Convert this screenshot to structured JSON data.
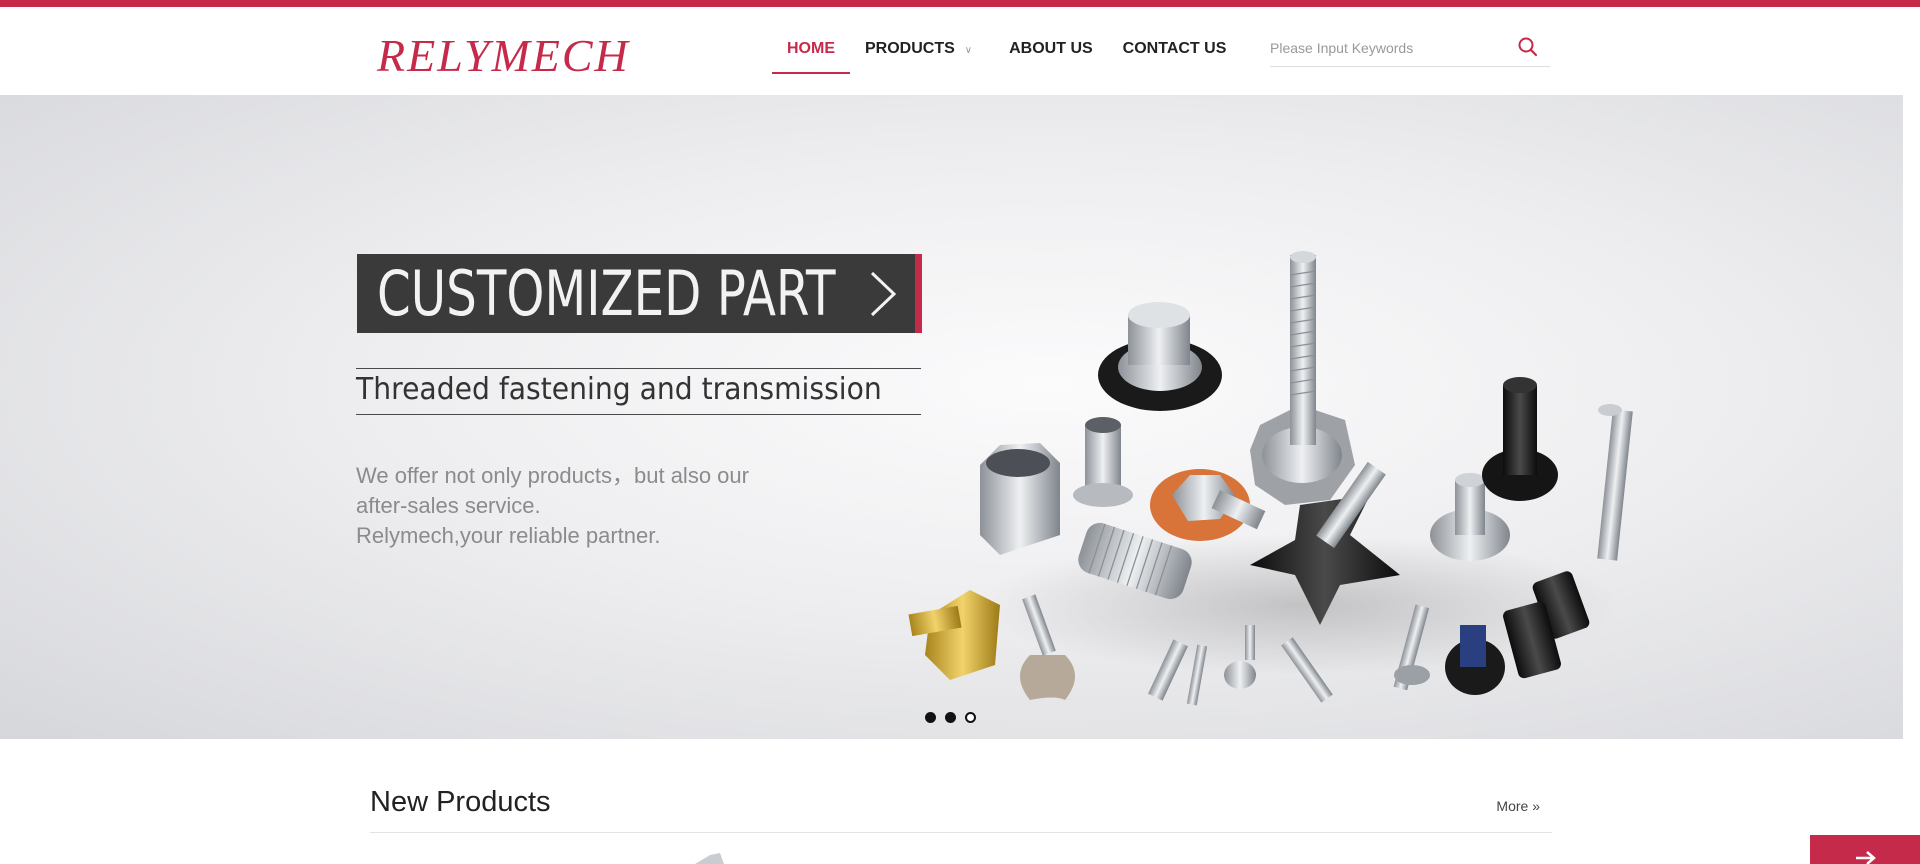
{
  "brand": {
    "logo": "RELYMECH",
    "accent": "#c62a4a"
  },
  "nav": {
    "items": [
      {
        "label": "HOME",
        "active": true
      },
      {
        "label": "PRODUCTS",
        "has_dropdown": true
      },
      {
        "label": "ABOUT US"
      },
      {
        "label": "CONTACT US"
      }
    ]
  },
  "search": {
    "placeholder": "Please Input Keywords",
    "value": "",
    "icon": "search-icon"
  },
  "banner": {
    "headline": "CUSTOMIZED PART",
    "subtitle": "Threaded fastening and transmission",
    "description_lines": [
      "We offer not only products，but also our",
      "after-sales service.",
      "Relymech,your reliable partner."
    ],
    "slides": [
      {
        "state": "filled"
      },
      {
        "state": "filled"
      },
      {
        "state": "hollow"
      }
    ]
  },
  "new_products": {
    "title": "New Products",
    "more_label": "More »"
  },
  "floating_button": {
    "icon": "arrow-right-icon"
  }
}
